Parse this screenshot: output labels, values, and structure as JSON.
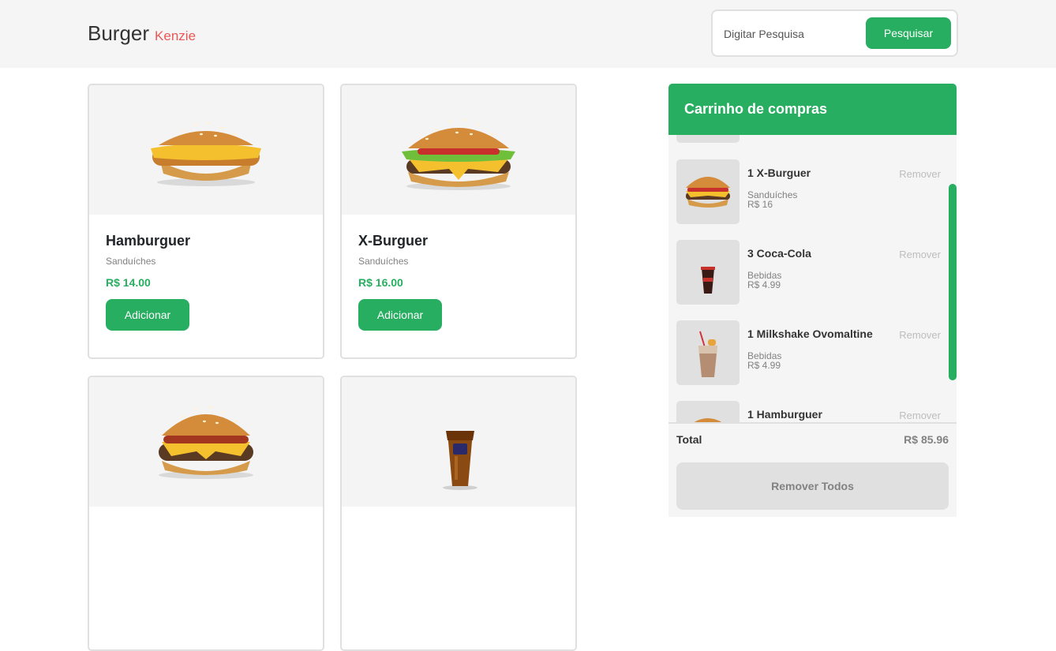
{
  "header": {
    "brand_main": "Burger",
    "brand_sub": "Kenzie",
    "search_placeholder": "Digitar Pesquisa",
    "search_button": "Pesquisar"
  },
  "products": [
    {
      "name": "Hamburguer",
      "category": "Sanduíches",
      "price": "R$ 14.00",
      "button": "Adicionar",
      "image": "chicken-burger-image"
    },
    {
      "name": "X-Burguer",
      "category": "Sanduíches",
      "price": "R$ 16.00",
      "button": "Adicionar",
      "image": "cheeseburger-image"
    },
    {
      "image": "double-burger-image"
    },
    {
      "image": "fanta-cup-image"
    }
  ],
  "cart": {
    "title": "Carrinho de compras",
    "items": [
      {
        "name": "1 X-Burguer",
        "category": "Sanduíches",
        "price": "R$ 16",
        "remove": "Remover",
        "image": "cheeseburger-thumb"
      },
      {
        "name": "3 Coca-Cola",
        "category": "Bebidas",
        "price": "R$ 4.99",
        "remove": "Remover",
        "image": "coca-cola-thumb"
      },
      {
        "name": "1 Milkshake Ovomaltine",
        "category": "Bebidas",
        "price": "R$ 4.99",
        "remove": "Remover",
        "image": "milkshake-thumb"
      },
      {
        "name": "1 Hamburguer",
        "remove": "Remover",
        "image": "burger-thumb"
      }
    ],
    "total_label": "Total",
    "total_value": "R$ 85.96",
    "remove_all": "Remover Todos"
  },
  "colors": {
    "accent": "#27ae60",
    "brand_secondary": "#eb5757",
    "header_bg": "#f5f5f5",
    "muted_text": "#828282"
  }
}
